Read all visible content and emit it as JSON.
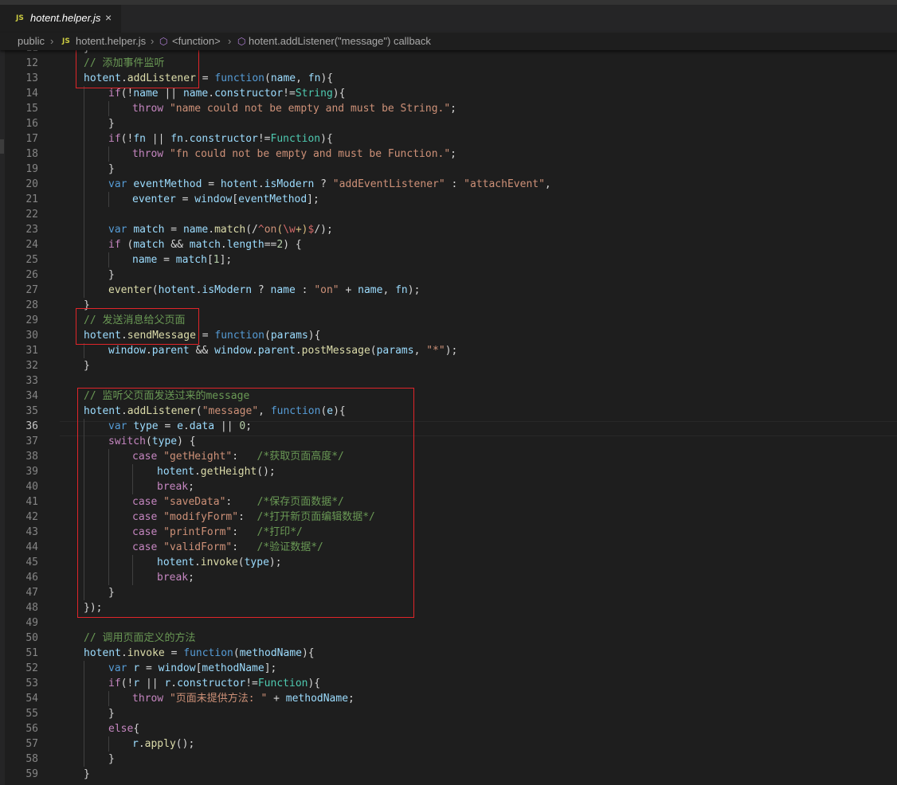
{
  "tab": {
    "icon": "JS",
    "title": "hotent.helper.js",
    "close_icon": "×"
  },
  "breadcrumb": {
    "folder": "public",
    "file_icon": "JS",
    "file": "hotent.helper.js",
    "scope1": "<function>",
    "scope2": "hotent.addListener(\"message\") callback",
    "separator": "›",
    "symbol_icon": "symbol-method-icon"
  },
  "editor": {
    "current_line": 36,
    "colors": {
      "keyword": "#569cd6",
      "control": "#c586c0",
      "string": "#ce9178",
      "comment": "#6a9955",
      "function": "#dcdcaa",
      "variable": "#9cdcfe",
      "type": "#4ec9b0",
      "number": "#b5cea8",
      "highlight_box": "#e0252a"
    },
    "lines": [
      {
        "n": "11",
        "indent": 1,
        "toks": [
          [
            "}",
            ""
          ]
        ]
      },
      {
        "n": "12",
        "indent": 1,
        "toks": [
          [
            "// 添加事件监听",
            "c"
          ]
        ]
      },
      {
        "n": "13",
        "indent": 1,
        "toks": [
          [
            "hotent",
            "v"
          ],
          [
            ".",
            ""
          ],
          [
            "addListener",
            "f"
          ],
          [
            " = ",
            ""
          ],
          [
            "function",
            "k"
          ],
          [
            "(",
            ""
          ],
          [
            "name",
            "v"
          ],
          [
            ", ",
            ""
          ],
          [
            "fn",
            "v"
          ],
          [
            "){",
            ""
          ]
        ]
      },
      {
        "n": "14",
        "indent": 2,
        "toks": [
          [
            "if",
            "ck"
          ],
          [
            "(!",
            ""
          ],
          [
            "name",
            "v"
          ],
          [
            " || ",
            ""
          ],
          [
            "name",
            "v"
          ],
          [
            ".",
            ""
          ],
          [
            "constructor",
            "v"
          ],
          [
            "!=",
            ""
          ],
          [
            "String",
            "t"
          ],
          [
            "){",
            ""
          ]
        ]
      },
      {
        "n": "15",
        "indent": 3,
        "toks": [
          [
            "throw",
            "ck"
          ],
          [
            " ",
            ""
          ],
          [
            "\"name could not be empty and must be String.\"",
            "s"
          ],
          [
            ";",
            ""
          ]
        ]
      },
      {
        "n": "16",
        "indent": 2,
        "toks": [
          [
            "}",
            ""
          ]
        ]
      },
      {
        "n": "17",
        "indent": 2,
        "toks": [
          [
            "if",
            "ck"
          ],
          [
            "(!",
            ""
          ],
          [
            "fn",
            "v"
          ],
          [
            " || ",
            ""
          ],
          [
            "fn",
            "v"
          ],
          [
            ".",
            ""
          ],
          [
            "constructor",
            "v"
          ],
          [
            "!=",
            ""
          ],
          [
            "Function",
            "t"
          ],
          [
            "){",
            ""
          ]
        ]
      },
      {
        "n": "18",
        "indent": 3,
        "toks": [
          [
            "throw",
            "ck"
          ],
          [
            " ",
            ""
          ],
          [
            "\"fn could not be empty and must be Function.\"",
            "s"
          ],
          [
            ";",
            ""
          ]
        ]
      },
      {
        "n": "19",
        "indent": 2,
        "toks": [
          [
            "}",
            ""
          ]
        ]
      },
      {
        "n": "20",
        "indent": 2,
        "toks": [
          [
            "var",
            "k"
          ],
          [
            " ",
            ""
          ],
          [
            "eventMethod",
            "v"
          ],
          [
            " = ",
            ""
          ],
          [
            "hotent",
            "v"
          ],
          [
            ".",
            ""
          ],
          [
            "isModern",
            "v"
          ],
          [
            " ? ",
            ""
          ],
          [
            "\"addEventListener\"",
            "s"
          ],
          [
            " : ",
            ""
          ],
          [
            "\"attachEvent\"",
            "s"
          ],
          [
            ",",
            ""
          ]
        ]
      },
      {
        "n": "21",
        "indent": 3,
        "toks": [
          [
            "eventer",
            "v"
          ],
          [
            " = ",
            ""
          ],
          [
            "window",
            "v"
          ],
          [
            "[",
            ""
          ],
          [
            "eventMethod",
            "v"
          ],
          [
            "];",
            ""
          ]
        ]
      },
      {
        "n": "22",
        "indent": 2,
        "toks": []
      },
      {
        "n": "23",
        "indent": 2,
        "toks": [
          [
            "var",
            "k"
          ],
          [
            " ",
            ""
          ],
          [
            "match",
            "v"
          ],
          [
            " = ",
            ""
          ],
          [
            "name",
            "v"
          ],
          [
            ".",
            ""
          ],
          [
            "match",
            "f"
          ],
          [
            "(",
            ""
          ],
          [
            "/",
            ""
          ],
          [
            "^",
            "r"
          ],
          [
            "on",
            "s"
          ],
          [
            "(",
            "re"
          ],
          [
            "\\w",
            "r"
          ],
          [
            "+",
            "re"
          ],
          [
            ")",
            "re"
          ],
          [
            "$",
            "r"
          ],
          [
            "/",
            ""
          ],
          [
            ");",
            ""
          ]
        ]
      },
      {
        "n": "24",
        "indent": 2,
        "toks": [
          [
            "if",
            "ck"
          ],
          [
            " (",
            ""
          ],
          [
            "match",
            "v"
          ],
          [
            " && ",
            ""
          ],
          [
            "match",
            "v"
          ],
          [
            ".",
            ""
          ],
          [
            "length",
            "v"
          ],
          [
            "==",
            ""
          ],
          [
            "2",
            "n"
          ],
          [
            ") {",
            ""
          ]
        ]
      },
      {
        "n": "25",
        "indent": 3,
        "toks": [
          [
            "name",
            "v"
          ],
          [
            " = ",
            ""
          ],
          [
            "match",
            "v"
          ],
          [
            "[",
            ""
          ],
          [
            "1",
            "n"
          ],
          [
            "];",
            ""
          ]
        ]
      },
      {
        "n": "26",
        "indent": 2,
        "toks": [
          [
            "}",
            ""
          ]
        ]
      },
      {
        "n": "27",
        "indent": 2,
        "toks": [
          [
            "eventer",
            "f"
          ],
          [
            "(",
            ""
          ],
          [
            "hotent",
            "v"
          ],
          [
            ".",
            ""
          ],
          [
            "isModern",
            "v"
          ],
          [
            " ? ",
            ""
          ],
          [
            "name",
            "v"
          ],
          [
            " : ",
            ""
          ],
          [
            "\"on\"",
            "s"
          ],
          [
            " + ",
            ""
          ],
          [
            "name",
            "v"
          ],
          [
            ", ",
            ""
          ],
          [
            "fn",
            "v"
          ],
          [
            ");",
            ""
          ]
        ]
      },
      {
        "n": "28",
        "indent": 1,
        "toks": [
          [
            "}",
            ""
          ]
        ]
      },
      {
        "n": "29",
        "indent": 1,
        "toks": [
          [
            "// 发送消息给父页面",
            "c"
          ]
        ]
      },
      {
        "n": "30",
        "indent": 1,
        "toks": [
          [
            "hotent",
            "v"
          ],
          [
            ".",
            ""
          ],
          [
            "sendMessage",
            "f"
          ],
          [
            " = ",
            ""
          ],
          [
            "function",
            "k"
          ],
          [
            "(",
            ""
          ],
          [
            "params",
            "v"
          ],
          [
            "){",
            ""
          ]
        ]
      },
      {
        "n": "31",
        "indent": 2,
        "toks": [
          [
            "window",
            "v"
          ],
          [
            ".",
            ""
          ],
          [
            "parent",
            "v"
          ],
          [
            " && ",
            ""
          ],
          [
            "window",
            "v"
          ],
          [
            ".",
            ""
          ],
          [
            "parent",
            "v"
          ],
          [
            ".",
            ""
          ],
          [
            "postMessage",
            "f"
          ],
          [
            "(",
            ""
          ],
          [
            "params",
            "v"
          ],
          [
            ", ",
            ""
          ],
          [
            "\"*\"",
            "s"
          ],
          [
            ");",
            ""
          ]
        ]
      },
      {
        "n": "32",
        "indent": 1,
        "toks": [
          [
            "}",
            ""
          ]
        ]
      },
      {
        "n": "33",
        "indent": 1,
        "toks": []
      },
      {
        "n": "34",
        "indent": 1,
        "toks": [
          [
            "// 监听父页面发送过来的message",
            "c"
          ]
        ]
      },
      {
        "n": "35",
        "indent": 1,
        "toks": [
          [
            "hotent",
            "v"
          ],
          [
            ".",
            ""
          ],
          [
            "addListener",
            "f"
          ],
          [
            "(",
            ""
          ],
          [
            "\"message\"",
            "s"
          ],
          [
            ", ",
            ""
          ],
          [
            "function",
            "k"
          ],
          [
            "(",
            ""
          ],
          [
            "e",
            "v"
          ],
          [
            "){",
            ""
          ]
        ]
      },
      {
        "n": "36",
        "indent": 2,
        "toks": [
          [
            "var",
            "k"
          ],
          [
            " ",
            ""
          ],
          [
            "type",
            "v"
          ],
          [
            " = ",
            ""
          ],
          [
            "e",
            "v"
          ],
          [
            ".",
            ""
          ],
          [
            "data",
            "v"
          ],
          [
            " || ",
            ""
          ],
          [
            "0",
            "n"
          ],
          [
            ";",
            ""
          ]
        ]
      },
      {
        "n": "37",
        "indent": 2,
        "toks": [
          [
            "switch",
            "ck"
          ],
          [
            "(",
            ""
          ],
          [
            "type",
            "v"
          ],
          [
            ") {",
            ""
          ]
        ]
      },
      {
        "n": "38",
        "indent": 3,
        "toks": [
          [
            "case",
            "ck"
          ],
          [
            " ",
            ""
          ],
          [
            "\"getHeight\"",
            "s"
          ],
          [
            ":   ",
            ""
          ],
          [
            "/*获取页面高度*/",
            "c"
          ]
        ]
      },
      {
        "n": "39",
        "indent": 4,
        "toks": [
          [
            "hotent",
            "v"
          ],
          [
            ".",
            ""
          ],
          [
            "getHeight",
            "f"
          ],
          [
            "();",
            ""
          ]
        ]
      },
      {
        "n": "40",
        "indent": 4,
        "toks": [
          [
            "break",
            "ck"
          ],
          [
            ";",
            ""
          ]
        ]
      },
      {
        "n": "41",
        "indent": 3,
        "toks": [
          [
            "case",
            "ck"
          ],
          [
            " ",
            ""
          ],
          [
            "\"saveData\"",
            "s"
          ],
          [
            ":    ",
            ""
          ],
          [
            "/*保存页面数据*/",
            "c"
          ]
        ]
      },
      {
        "n": "42",
        "indent": 3,
        "toks": [
          [
            "case",
            "ck"
          ],
          [
            " ",
            ""
          ],
          [
            "\"modifyForm\"",
            "s"
          ],
          [
            ":  ",
            ""
          ],
          [
            "/*打开新页面编辑数据*/",
            "c"
          ]
        ]
      },
      {
        "n": "43",
        "indent": 3,
        "toks": [
          [
            "case",
            "ck"
          ],
          [
            " ",
            ""
          ],
          [
            "\"printForm\"",
            "s"
          ],
          [
            ":   ",
            ""
          ],
          [
            "/*打印*/",
            "c"
          ]
        ]
      },
      {
        "n": "44",
        "indent": 3,
        "toks": [
          [
            "case",
            "ck"
          ],
          [
            " ",
            ""
          ],
          [
            "\"validForm\"",
            "s"
          ],
          [
            ":   ",
            ""
          ],
          [
            "/*验证数据*/",
            "c"
          ]
        ]
      },
      {
        "n": "45",
        "indent": 4,
        "toks": [
          [
            "hotent",
            "v"
          ],
          [
            ".",
            ""
          ],
          [
            "invoke",
            "f"
          ],
          [
            "(",
            ""
          ],
          [
            "type",
            "v"
          ],
          [
            ");",
            ""
          ]
        ]
      },
      {
        "n": "46",
        "indent": 4,
        "toks": [
          [
            "break",
            "ck"
          ],
          [
            ";",
            ""
          ]
        ]
      },
      {
        "n": "47",
        "indent": 2,
        "toks": [
          [
            "}",
            ""
          ]
        ]
      },
      {
        "n": "48",
        "indent": 1,
        "toks": [
          [
            "});",
            ""
          ]
        ]
      },
      {
        "n": "49",
        "indent": 1,
        "toks": []
      },
      {
        "n": "50",
        "indent": 1,
        "toks": [
          [
            "// 调用页面定义的方法",
            "c"
          ]
        ]
      },
      {
        "n": "51",
        "indent": 1,
        "toks": [
          [
            "hotent",
            "v"
          ],
          [
            ".",
            ""
          ],
          [
            "invoke",
            "f"
          ],
          [
            " = ",
            ""
          ],
          [
            "function",
            "k"
          ],
          [
            "(",
            ""
          ],
          [
            "methodName",
            "v"
          ],
          [
            "){",
            ""
          ]
        ]
      },
      {
        "n": "52",
        "indent": 2,
        "toks": [
          [
            "var",
            "k"
          ],
          [
            " ",
            ""
          ],
          [
            "r",
            "v"
          ],
          [
            " = ",
            ""
          ],
          [
            "window",
            "v"
          ],
          [
            "[",
            ""
          ],
          [
            "methodName",
            "v"
          ],
          [
            "];",
            ""
          ]
        ]
      },
      {
        "n": "53",
        "indent": 2,
        "toks": [
          [
            "if",
            "ck"
          ],
          [
            "(!",
            ""
          ],
          [
            "r",
            "v"
          ],
          [
            " || ",
            ""
          ],
          [
            "r",
            "v"
          ],
          [
            ".",
            ""
          ],
          [
            "constructor",
            "v"
          ],
          [
            "!=",
            ""
          ],
          [
            "Function",
            "t"
          ],
          [
            "){",
            ""
          ]
        ]
      },
      {
        "n": "54",
        "indent": 3,
        "toks": [
          [
            "throw",
            "ck"
          ],
          [
            " ",
            ""
          ],
          [
            "\"页面未提供方法: \"",
            "s"
          ],
          [
            " + ",
            ""
          ],
          [
            "methodName",
            "v"
          ],
          [
            ";",
            ""
          ]
        ]
      },
      {
        "n": "55",
        "indent": 2,
        "toks": [
          [
            "}",
            ""
          ]
        ]
      },
      {
        "n": "56",
        "indent": 2,
        "toks": [
          [
            "else",
            "ck"
          ],
          [
            "{",
            ""
          ]
        ]
      },
      {
        "n": "57",
        "indent": 3,
        "toks": [
          [
            "r",
            "v"
          ],
          [
            ".",
            ""
          ],
          [
            "apply",
            "f"
          ],
          [
            "();",
            ""
          ]
        ]
      },
      {
        "n": "58",
        "indent": 2,
        "toks": [
          [
            "}",
            ""
          ]
        ]
      },
      {
        "n": "59",
        "indent": 1,
        "toks": [
          [
            "}",
            ""
          ]
        ]
      }
    ]
  }
}
